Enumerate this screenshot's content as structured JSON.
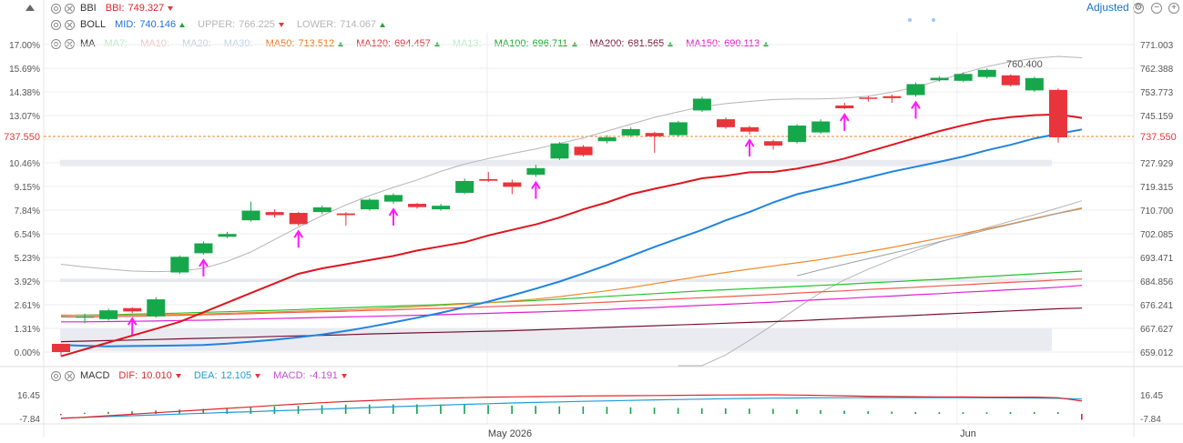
{
  "legend": {
    "bbi": {
      "name": "BBI",
      "items": [
        {
          "label": "BBI:",
          "value": "749.327",
          "dir": "down",
          "color": "#e0252b"
        }
      ]
    },
    "boll": {
      "name": "BOLL",
      "items": [
        {
          "label": "MID:",
          "value": "740.146",
          "dir": "up",
          "color": "#1f6fe0"
        },
        {
          "label": "UPPER:",
          "value": "766.225",
          "dir": "down",
          "color": "#b5b5b5"
        },
        {
          "label": "LOWER:",
          "value": "714.067",
          "dir": "up",
          "color": "#b5b5b5"
        }
      ]
    },
    "ma": {
      "name": "MA",
      "items": [
        {
          "label": "MA7:",
          "value": "",
          "dir": "",
          "color": "#b9ecc4"
        },
        {
          "label": "MA10:",
          "value": "",
          "dir": "",
          "color": "#f2c4c4"
        },
        {
          "label": "MA20:",
          "value": "",
          "dir": "",
          "color": "#c6d0d6"
        },
        {
          "label": "MA30:",
          "value": "",
          "dir": "",
          "color": "#bfd2ee"
        },
        {
          "label": "MA50:",
          "value": "713.512",
          "dir": "up",
          "color": "#e9761f"
        },
        {
          "label": "MA120:",
          "value": "694.457",
          "dir": "up",
          "color": "#e2343b"
        },
        {
          "label": "MA13:",
          "value": "",
          "dir": "",
          "color": "#b9ecc4"
        },
        {
          "label": "MA100:",
          "value": "696.711",
          "dir": "up",
          "color": "#1aa72c"
        },
        {
          "label": "MA200:",
          "value": "681.565",
          "dir": "up",
          "color": "#6e1030"
        },
        {
          "label": "MA150:",
          "value": "690.113",
          "dir": "up",
          "color": "#e018cc"
        }
      ]
    },
    "macd": {
      "name": "MACD",
      "items": [
        {
          "label": "DIF:",
          "value": "10.010",
          "dir": "down",
          "color": "#e0252b"
        },
        {
          "label": "DEA:",
          "value": "12.105",
          "dir": "down",
          "color": "#1e9bd6"
        },
        {
          "label": "MACD:",
          "value": "-4.191",
          "dir": "down",
          "color": "#c94bd8"
        }
      ]
    }
  },
  "header": {
    "adjusted_label": "Adjusted"
  },
  "colors": {
    "up": "#16a74a",
    "down": "#e8353b",
    "mid": "#1f83e0",
    "bbi": "#e0141e",
    "band": "#b5b5b5",
    "grid": "#eeeeee"
  },
  "chart_data": {
    "type": "candlestick",
    "y_left_ticks": [
      "17.00%",
      "15.69%",
      "14.38%",
      "13.07%",
      "11.77%",
      "10.46%",
      "9.15%",
      "7.84%",
      "6.54%",
      "5.23%",
      "3.92%",
      "2.61%",
      "1.31%",
      "0.00%"
    ],
    "y_right_ticks": [
      "771.003",
      "762.388",
      "753.773",
      "745.159",
      "736.544",
      "727.929",
      "719.315",
      "710.700",
      "702.085",
      "693.471",
      "684.856",
      "676.241",
      "667.627",
      "659.012"
    ],
    "ylim": [
      659.012,
      771.003
    ],
    "current_price": "737.550",
    "max_label": "760.400",
    "x_labels": [
      "May 2026",
      "Jun"
    ],
    "candles": [
      [
        662,
        659,
        662,
        657.5
      ],
      [
        671.5,
        672,
        673,
        669.5
      ],
      [
        671,
        674.2,
        674.8,
        670.5
      ],
      [
        675,
        673.8,
        675.3,
        673.2
      ],
      [
        672,
        678.2,
        679,
        671.5
      ],
      [
        688,
        693.7,
        694.2,
        687.5
      ],
      [
        695,
        698.6,
        699.3,
        694.5
      ],
      [
        701,
        702,
        702.8,
        700.5
      ],
      [
        707,
        710.5,
        713.8,
        706.5
      ],
      [
        710,
        708.9,
        711,
        708
      ],
      [
        709.7,
        705.6,
        710,
        705
      ],
      [
        710,
        711.7,
        712.4,
        709.2
      ],
      [
        709.5,
        708.9,
        710,
        705
      ],
      [
        711,
        714.5,
        715,
        710.5
      ],
      [
        713.8,
        716.2,
        716.8,
        713
      ],
      [
        713,
        711.8,
        713.3,
        711.2
      ],
      [
        711,
        712.3,
        713,
        710.5
      ],
      [
        717,
        721.3,
        722.2,
        716.5
      ],
      [
        722,
        721.4,
        724.6,
        721
      ],
      [
        720.8,
        719.2,
        721.8,
        716.5
      ],
      [
        723.6,
        726,
        727.2,
        722.8
      ],
      [
        729.5,
        735,
        735.5,
        729
      ],
      [
        733.8,
        730.7,
        734.4,
        730.2
      ],
      [
        735.8,
        737.2,
        738,
        735
      ],
      [
        737.9,
        740.2,
        740.9,
        737.3
      ],
      [
        738.8,
        737.6,
        739.2,
        731.6
      ],
      [
        738,
        742.7,
        743.2,
        737.5
      ],
      [
        747,
        751.3,
        752,
        746.5
      ],
      [
        743.8,
        740.9,
        744.5,
        740.3
      ],
      [
        740.9,
        739.3,
        741.4,
        738.2
      ],
      [
        735.8,
        734.2,
        736.3,
        732.8
      ],
      [
        735.5,
        741.5,
        742,
        735
      ],
      [
        739,
        743,
        743.8,
        738.5
      ],
      [
        748.8,
        747.8,
        749.8,
        747.5
      ],
      [
        751.7,
        751.3,
        752.2,
        750.2
      ],
      [
        752.2,
        751.5,
        752.8,
        749.8
      ],
      [
        752.6,
        756.6,
        757.2,
        752
      ],
      [
        758,
        758.9,
        759.5,
        757.5
      ],
      [
        757.8,
        760.3,
        760.9,
        757.3
      ],
      [
        759.2,
        761.8,
        762.3,
        758.7
      ],
      [
        759.8,
        756.2,
        760.2,
        755.7
      ],
      [
        754.3,
        758.8,
        759.3,
        753.8
      ],
      [
        754.5,
        737.2,
        755,
        735.3
      ]
    ],
    "series": [
      {
        "name": "BBI",
        "values": [
          657.5,
          660,
          662.5,
          665,
          667.5,
          670,
          673.5,
          677,
          680.5,
          684,
          687.5,
          689.5,
          691,
          692.5,
          694,
          696,
          697.5,
          699,
          701.5,
          703.5,
          705.5,
          708,
          711,
          713.5,
          716.5,
          718.5,
          720.3,
          722.3,
          723.2,
          724.5,
          724.6,
          725.8,
          727.5,
          729.5,
          732,
          734.5,
          737,
          739.5,
          741.6,
          743.5,
          744.6,
          745.3,
          745.6,
          744.3
        ]
      },
      {
        "name": "MID",
        "values": [
          661.6,
          661.3,
          661.1,
          661.2,
          661.3,
          661.4,
          661.6,
          662.1,
          662.8,
          663.5,
          664.4,
          665.4,
          666.7,
          668.2,
          669.8,
          671.5,
          673.3,
          675.3,
          677.4,
          679.7,
          682.1,
          684.7,
          687.6,
          690.7,
          694,
          697.3,
          700.4,
          703.5,
          707,
          710,
          713.5,
          716.5,
          718.5,
          720.5,
          722.6,
          724.7,
          726.5,
          728.3,
          730.2,
          732.5,
          734.5,
          736.8,
          738.5,
          740.1
        ]
      },
      {
        "name": "UPPER",
        "values": [
          691,
          690,
          689.2,
          688.5,
          688.3,
          688.5,
          689.5,
          692,
          695.5,
          700,
          704.5,
          708.7,
          712.6,
          716,
          719,
          721.7,
          724.8,
          727.5,
          729.5,
          731.3,
          733,
          735,
          737,
          739.5,
          742,
          744.5,
          746.5,
          748.4,
          749.5,
          750.3,
          751,
          751.2,
          751.2,
          751.5,
          752.2,
          753.7,
          755.5,
          758,
          760.6,
          763,
          764.8,
          766,
          766.7,
          766.2
        ]
      },
      {
        "name": "LOWER",
        "values": [
          null,
          null,
          null,
          null,
          null,
          null,
          null,
          null,
          null,
          null,
          null,
          null,
          null,
          null,
          null,
          null,
          null,
          null,
          null,
          null,
          null,
          null,
          null,
          null,
          null,
          null,
          647.7,
          652.5,
          658,
          663.3,
          669,
          675,
          680.7,
          685.3,
          689.2,
          692.7,
          695.9,
          699,
          701.6,
          704.3,
          706.7,
          709,
          711.5,
          714.1
        ]
      },
      {
        "name": "MA50",
        "values": [
          672.5,
          672.4,
          672.4,
          672.5,
          672.6,
          672.7,
          672.9,
          673.1,
          673.4,
          673.6,
          673.9,
          674.1,
          674.4,
          674.7,
          675.1,
          675.5,
          676,
          676.5,
          677,
          677.6,
          678.3,
          679.2,
          680.3,
          681.3,
          682.5,
          683.9,
          685.3,
          686.7,
          688,
          689.2,
          690.4,
          691.5,
          692.7,
          694.2,
          695.6,
          697.1,
          698.8,
          700.5,
          702.2,
          703.9,
          705.7,
          707.7,
          709.6,
          711.5
        ]
      },
      {
        "name": "MA120",
        "values": [
          671.8,
          671.8,
          671.9,
          672,
          672.2,
          672.4,
          672.6,
          672.8,
          673,
          673.3,
          673.5,
          673.7,
          673.9,
          674.2,
          674.4,
          674.7,
          674.9,
          675.2,
          675.5,
          675.8,
          676.1,
          676.4,
          676.8,
          677.2,
          677.6,
          678,
          678.4,
          678.8,
          679.2,
          679.6,
          680,
          680.5,
          680.9,
          681.3,
          681.8,
          682.2,
          682.6,
          683.1,
          683.5,
          684,
          684.4,
          684.8,
          685.3,
          685.6
        ]
      },
      {
        "name": "MA100",
        "values": [
          672.3,
          672.5,
          672.6,
          672.8,
          673,
          673.2,
          673.5,
          673.7,
          674,
          674.2,
          674.5,
          674.8,
          675.1,
          675.4,
          675.7,
          676,
          676.3,
          676.7,
          677,
          677.4,
          677.8,
          678.3,
          678.8,
          679.3,
          679.8,
          680.3,
          680.8,
          681.3,
          681.7,
          682.1,
          682.5,
          682.9,
          683.3,
          683.7,
          684.2,
          684.6,
          685.1,
          685.5,
          686,
          686.5,
          687,
          687.5,
          688,
          688.5
        ]
      },
      {
        "name": "MA200",
        "values": [
          662.8,
          663,
          663.2,
          663.4,
          663.6,
          663.8,
          664,
          664.2,
          664.4,
          664.7,
          664.9,
          665.1,
          665.3,
          665.6,
          665.8,
          666,
          666.2,
          666.4,
          666.6,
          666.8,
          667.1,
          667.4,
          667.7,
          668,
          668.3,
          668.6,
          668.9,
          669.2,
          669.5,
          669.8,
          670.1,
          670.4,
          670.8,
          671.2,
          671.6,
          672,
          672.4,
          672.8,
          673.2,
          673.6,
          674,
          674.4,
          674.8,
          675
        ]
      },
      {
        "name": "MA150",
        "values": [
          670,
          670,
          670.1,
          670.2,
          670.3,
          670.5,
          670.6,
          670.8,
          671,
          671.2,
          671.4,
          671.6,
          671.8,
          672,
          672.2,
          672.4,
          672.6,
          672.9,
          673.1,
          673.4,
          673.6,
          673.9,
          674.2,
          674.5,
          674.9,
          675.2,
          675.6,
          676,
          676.4,
          676.8,
          677.2,
          677.7,
          678.1,
          678.5,
          679,
          679.4,
          679.9,
          680.3,
          680.8,
          681.2,
          681.7,
          682.1,
          682.6,
          683.3
        ]
      },
      {
        "name": "MA30",
        "values": [
          null,
          null,
          null,
          null,
          null,
          null,
          null,
          null,
          null,
          null,
          null,
          null,
          null,
          null,
          null,
          null,
          null,
          null,
          null,
          null,
          null,
          null,
          null,
          null,
          null,
          null,
          null,
          null,
          null,
          null,
          null,
          686.8,
          689,
          691,
          693,
          695,
          697,
          699.2,
          701.4,
          703.5,
          705.5,
          707.5,
          709.5,
          711.2
        ]
      }
    ],
    "signals": [
      3,
      6,
      10,
      14,
      20,
      29,
      33,
      36
    ],
    "macd": {
      "ticks": [
        "16.45",
        "-7.84"
      ],
      "ylim": [
        -7.84,
        16.45
      ],
      "dif": [
        -7.84,
        -6.5,
        -5,
        -3.5,
        -2,
        -0.5,
        1,
        2.5,
        4,
        5.5,
        7,
        8.3,
        9.5,
        10.5,
        11.5,
        12.3,
        13,
        13.5,
        14,
        14.3,
        14.6,
        14.9,
        15.2,
        15.4,
        15.5,
        15.7,
        15.9,
        16.1,
        16.3,
        16.4,
        16.45,
        16.2,
        15.8,
        15.4,
        15,
        14.8,
        14.5,
        14.3,
        14.2,
        14,
        14,
        14,
        13.5,
        10.01
      ],
      "dea": [
        -7.5,
        -6.7,
        -5.9,
        -5,
        -4.2,
        -3.4,
        -2.5,
        -1.7,
        -0.9,
        0,
        0.8,
        1.7,
        2.5,
        3.4,
        4.2,
        5,
        5.8,
        6.6,
        7.3,
        8,
        8.6,
        9.2,
        9.7,
        10.2,
        10.7,
        11.2,
        11.6,
        12,
        12.4,
        12.7,
        13,
        13.2,
        13.4,
        13.5,
        13.6,
        13.6,
        13.6,
        13.6,
        13.5,
        13.4,
        13.3,
        13.2,
        12.8,
        12.1
      ],
      "hist": [
        -0.3,
        0.2,
        0.9,
        1.5,
        2.2,
        2.9,
        3.5,
        4.2,
        4.9,
        5.5,
        6.2,
        6.6,
        7,
        7.1,
        7.3,
        7.3,
        7.2,
        6.9,
        6.7,
        6.3,
        6,
        5.7,
        5.5,
        5.2,
        4.8,
        4.5,
        4.3,
        4.1,
        3.9,
        3.7,
        3.45,
        3,
        2.4,
        1.9,
        1.4,
        1.2,
        0.9,
        0.7,
        0.7,
        0.6,
        0.7,
        0.8,
        0.7,
        -4.19
      ]
    }
  }
}
